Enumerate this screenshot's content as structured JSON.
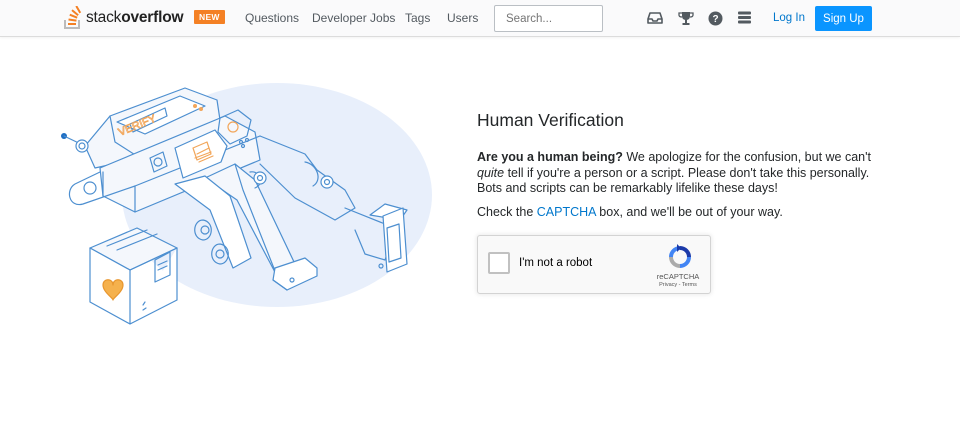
{
  "header": {
    "logo": {
      "text_light": "stack",
      "text_bold": "overflow"
    },
    "badge": "NEW",
    "nav": [
      {
        "label": "Questions"
      },
      {
        "label": "Developer Jobs"
      },
      {
        "label": "Tags"
      },
      {
        "label": "Users"
      }
    ],
    "search": {
      "placeholder": "Search..."
    },
    "icons": [
      "inbox-icon",
      "achievements-icon",
      "help-icon",
      "site-switcher-icon"
    ],
    "login_label": "Log In",
    "signup_label": "Sign Up"
  },
  "main": {
    "title": "Human Verification",
    "intro_bold": "Are you a human being?",
    "intro_1": " We apologize for the confusion, but we can't ",
    "intro_italic": "quite",
    "intro_2": " tell if you're a person or a script. Please don't take this personally. Bots and scripts can be remarkably lifelike these days!",
    "check_prefix": "Check the ",
    "check_link": "CAPTCHA",
    "check_suffix": " box, and we'll be out of your way.",
    "robot_screen_text": "VERIFY"
  },
  "recaptcha": {
    "label": "I'm not a robot",
    "brand": "reCAPTCHA",
    "privacy": "Privacy",
    "separator": " - ",
    "terms": "Terms"
  },
  "colors": {
    "brand_orange": "#f48024",
    "link_blue": "#0077cc",
    "button_blue": "#0a95ff",
    "illustration_bg": "#e8effb",
    "illustration_stroke": "#4d8fd0"
  }
}
